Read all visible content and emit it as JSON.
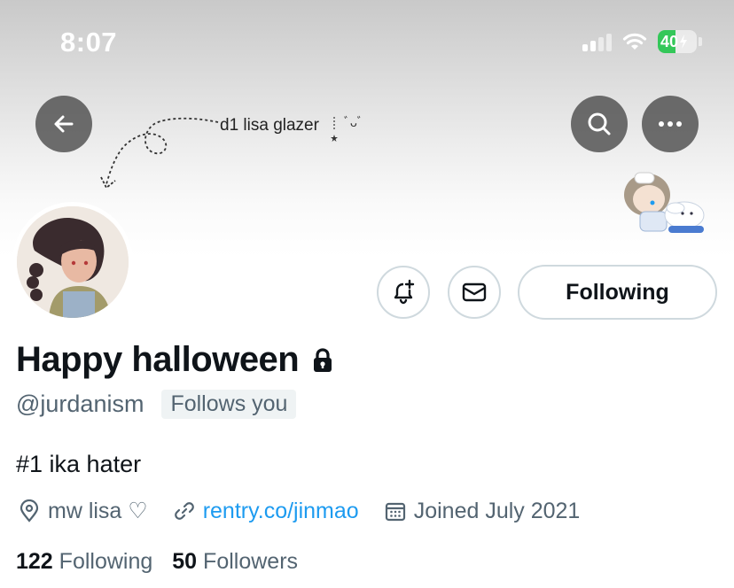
{
  "status_bar": {
    "time": "8:07",
    "battery": "40"
  },
  "banner": {
    "text": "d1 lisa glazer",
    "emoticon": "ﾞᴗﾞ"
  },
  "header_buttons": {
    "back_icon": "arrow-left-icon",
    "search_icon": "search-icon",
    "more_icon": "more-icon"
  },
  "actions": {
    "notify_icon": "bell-plus-icon",
    "message_icon": "envelope-icon",
    "following_label": "Following"
  },
  "profile": {
    "display_name": "Happy halloween",
    "lock_icon": "lock-icon",
    "handle": "@jurdanism",
    "follows_you": "Follows you",
    "bio": "#1 ika hater",
    "location": "mw lisa ♡",
    "website": "rentry.co/jinmao",
    "joined": "Joined July 2021"
  },
  "stats": {
    "following_count": "122",
    "following_label": "Following",
    "followers_count": "50",
    "followers_label": "Followers"
  },
  "colors": {
    "link": "#1d9bf0",
    "secondary_text": "#536471",
    "border": "#cfd9de",
    "battery_green": "#34c759"
  }
}
